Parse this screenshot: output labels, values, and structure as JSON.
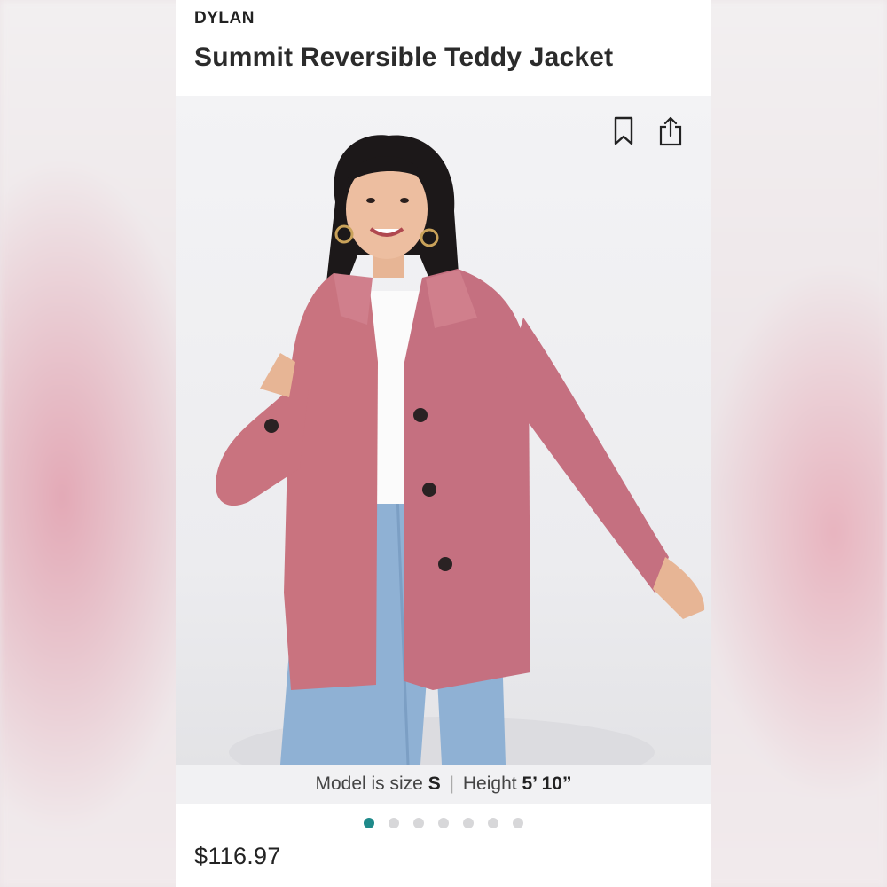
{
  "product": {
    "brand": "DYLAN",
    "title": "Summit Reversible Teddy Jacket",
    "price": "$116.97"
  },
  "gallery": {
    "image_count": 7,
    "active_index": 0,
    "icons": [
      "bookmark-icon",
      "share-icon"
    ]
  },
  "caption": {
    "size_label": "Model is size",
    "size_value": "S",
    "separator": "|",
    "height_label": "Height",
    "height_value": "5’ 10”"
  },
  "colors": {
    "accent": "#1f8a8a",
    "jacket": "#c9737f",
    "inactive_dot": "#d7d7d9"
  }
}
